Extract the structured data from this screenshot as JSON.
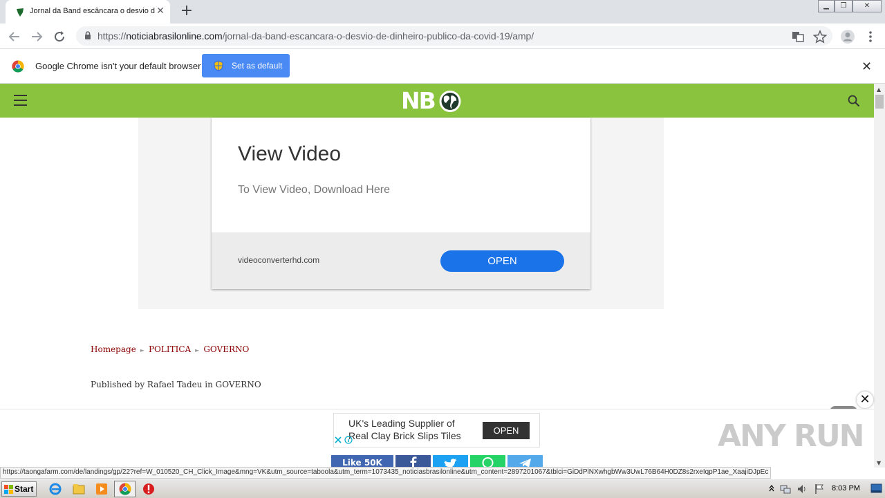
{
  "browser": {
    "tab_title": "Jornal da Band escâncara o desvio d",
    "tab_close": "✕",
    "new_tab": "+",
    "window_buttons": {
      "minimize": "▁",
      "restore": "❐",
      "close": "✕"
    },
    "url_scheme": "https://",
    "url_host": "noticiabrasilonline.com",
    "url_path": "/jornal-da-band-escancara-o-desvio-de-dinheiro-publico-da-covid-19/amp/"
  },
  "infobar": {
    "message": "Google Chrome isn't your default browser",
    "button_label": "Set as default",
    "close": "✕"
  },
  "site": {
    "logo_text": "NB",
    "ad": {
      "headline": "View Video",
      "subtext": "To View Video, Download Here",
      "domain": "videoconverterhd.com",
      "cta": "OPEN"
    },
    "breadcrumb": [
      "Homepage",
      "POLITICA",
      "GOVERNO"
    ],
    "breadcrumb_separator": "►",
    "byline": "Published by Rafael Tadeu in GOVERNO"
  },
  "sticky_ad": {
    "close": "✕",
    "line1": "UK's Leading Supplier of",
    "line2": "Real Clay Brick Slips Tiles",
    "cta": "OPEN",
    "share_like": "Like 50K"
  },
  "watermark": "ANY RUN",
  "status_url": "https://taongafarm.com/de/landings/gp/22?ref=W_010520_CH_Click_Image&mng=VK&utm_source=taboola&utm_term=1073435_noticiasbrasilonline&utm_content=2897201067&tblci=GiDdPlNXwhgbWw3UwL76B64H0DZ8s2rxeIqpP1ae_XaajiDJpEc",
  "taskbar": {
    "start_label": "Start",
    "clock": "8:03 PM"
  },
  "colors": {
    "site_header": "#8ac43f",
    "ad_cta": "#1a73e8",
    "breadcrumb": "#8b0000",
    "infobar_button": "#4a8af4"
  }
}
